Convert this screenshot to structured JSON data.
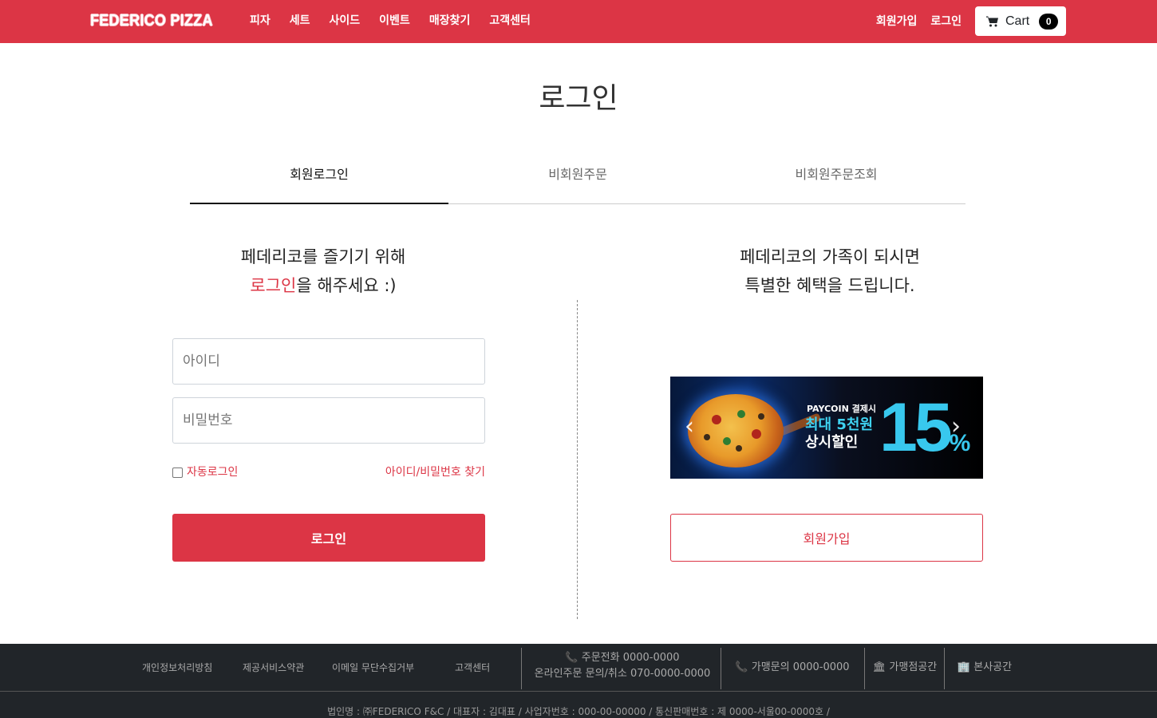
{
  "navbar": {
    "brand": "FEDERICO PIZZA",
    "menu": [
      "피자",
      "세트",
      "사이드",
      "이벤트",
      "매장찾기",
      "고객센터"
    ],
    "signup": "회원가입",
    "login": "로그인",
    "cart_label": "Cart",
    "cart_count": "0"
  },
  "page": {
    "title": "로그인"
  },
  "tabs": [
    {
      "label": "회원로그인",
      "active": true
    },
    {
      "label": "비회원주문",
      "active": false
    },
    {
      "label": "비회원주문조회",
      "active": false
    }
  ],
  "left": {
    "heading_line1": "페데리코를 즐기기 위해",
    "heading_accent": "로그인",
    "heading_line2_rest": "을 해주세요 :)",
    "id_placeholder": "아이디",
    "pw_placeholder": "비밀번호",
    "auto_login": "자동로그인",
    "find_account": "아이디/비밀번호 찾기",
    "login_button": "로그인"
  },
  "right": {
    "heading_line1": "페데리코의 가족이 되시면",
    "heading_line2": "특별한 혜택을 드립니다.",
    "banner": {
      "small": "PAYCOIN 결제시",
      "line1": "최대 5천원",
      "line2": "상시할인",
      "percent": "15",
      "percent_sign": "%"
    },
    "join_button": "회원가입"
  },
  "footer": {
    "links": [
      "개인정보처리방침",
      "제공서비스약관",
      "이메일 무단수집거부",
      "고객센터"
    ],
    "order_phone": "주문전화 0000-0000",
    "online_inquiry": "온라인주문 문의/취소 070-0000-0000",
    "franchise_phone": "가맹문의 0000-0000",
    "franchise_space": "가맹점공간",
    "hq_space": "본사공간",
    "company_info": "법인명 : ㈜FEDERICO F&C / 대표자 : 김대표 / 사업자번호 : 000-00-00000 / 통신판매번호 : 제 0000-서울00-0000호 /"
  }
}
